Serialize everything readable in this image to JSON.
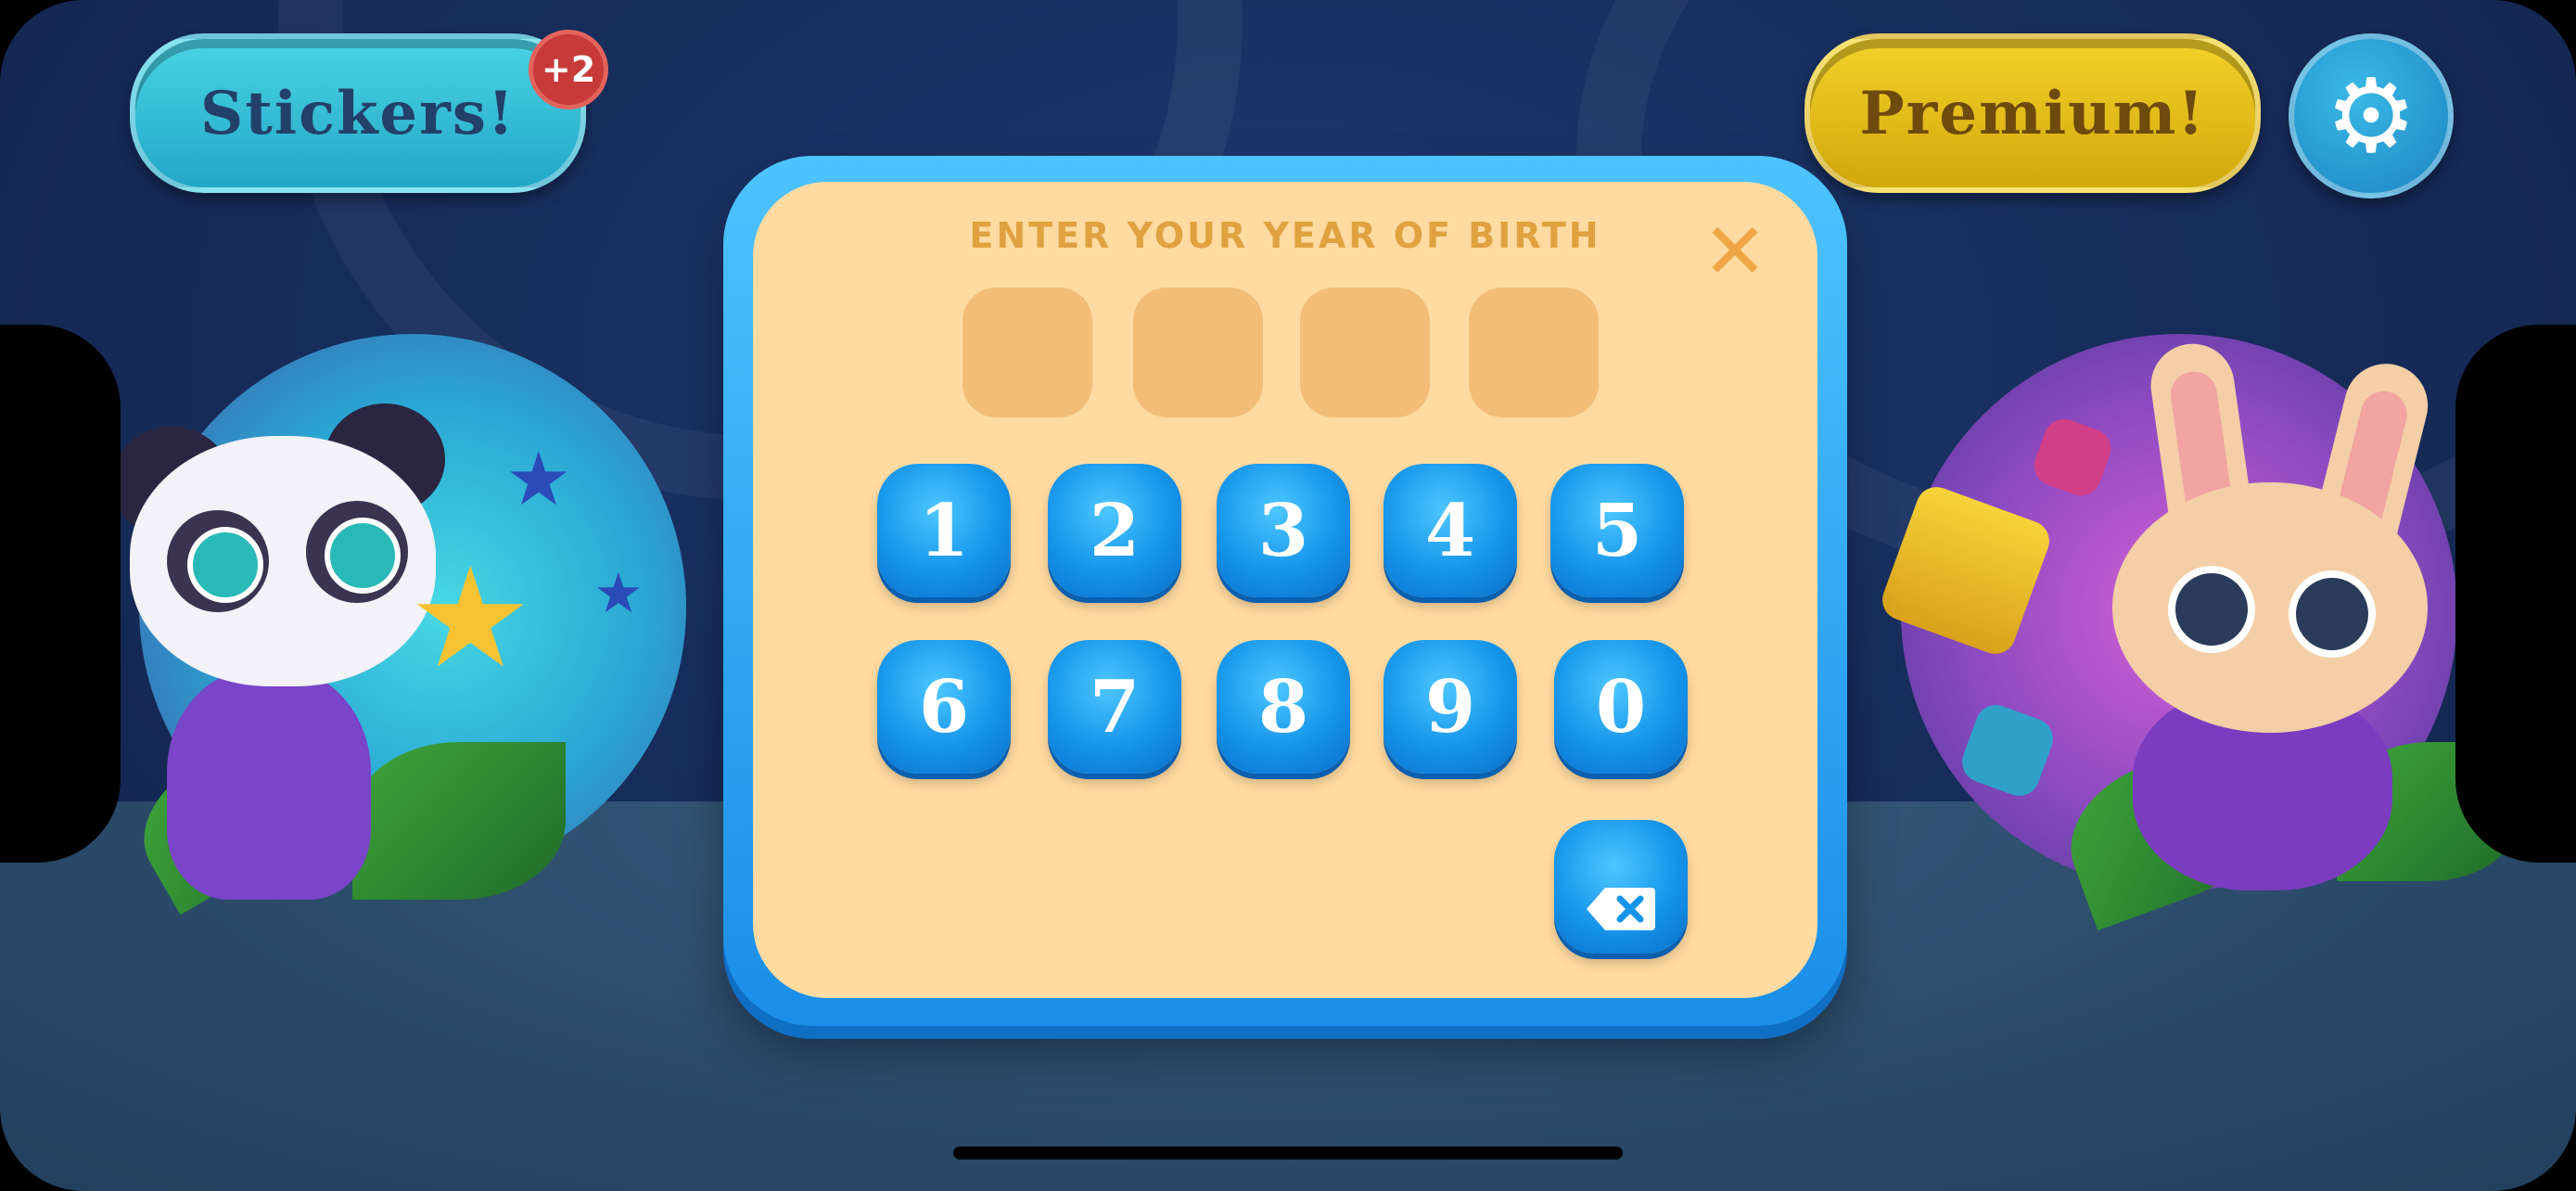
{
  "top_bar": {
    "stickers_label": "Stickers!",
    "stickers_badge": "+2",
    "premium_label": "Premium!",
    "settings_icon": "gear-icon"
  },
  "dialog": {
    "title": "ENTER YOUR YEAR OF BIRTH",
    "close_icon": "close-icon",
    "digit_slots": [
      "",
      "",
      "",
      ""
    ],
    "keys_row1": [
      "1",
      "2",
      "3",
      "4",
      "5"
    ],
    "keys_row2": [
      "6",
      "7",
      "8",
      "9",
      "0"
    ],
    "backspace_icon": "backspace-icon"
  },
  "colors": {
    "background": "#172d5c",
    "dialog_fill": "#ffdba1",
    "dialog_border": "#1a8ee8",
    "key_blue": "#1594ea",
    "title_color": "#e0a141",
    "stickers_pill": "#23a7c6",
    "premium_pill": "#d2a80c",
    "badge_red": "#c73a3a"
  }
}
